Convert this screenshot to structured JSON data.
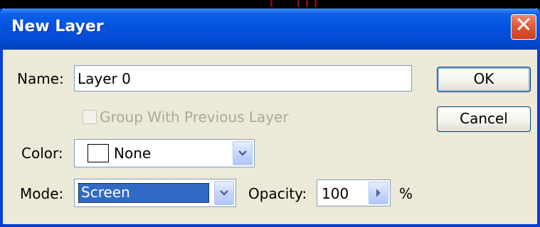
{
  "dialog": {
    "title": "New Layer",
    "close_symbol": "✕"
  },
  "name_row": {
    "label": "Name:",
    "value": "Layer 0"
  },
  "group_checkbox": {
    "label": "Group With Previous Layer",
    "checked": false,
    "enabled": false
  },
  "color_row": {
    "label": "Color:",
    "value": "None",
    "swatch_color": "#ffffff"
  },
  "mode_row": {
    "label": "Mode:",
    "value": "Screen"
  },
  "opacity_row": {
    "label": "Opacity:",
    "value": "100",
    "unit": "%"
  },
  "buttons": {
    "ok": "OK",
    "cancel": "Cancel"
  },
  "icons": {
    "close": "close-x-icon",
    "dropdown": "chevron-down-icon",
    "slider": "chevron-right-icon"
  },
  "colors": {
    "titlebar": "#0552e0",
    "dialog_bg": "#ece9d8",
    "close_button": "#e25a36",
    "selection": "#316ac5",
    "disabled_text": "#aca899"
  }
}
